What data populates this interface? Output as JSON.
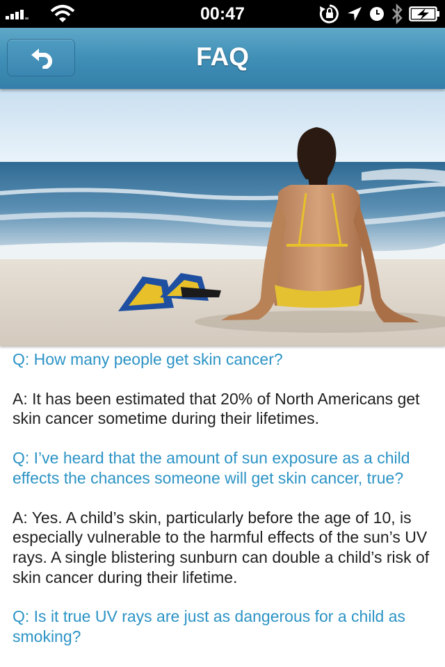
{
  "status_bar": {
    "time": "00:47"
  },
  "nav": {
    "title": "FAQ"
  },
  "faq": [
    {
      "q": "Q:  How many people get skin cancer?",
      "a": "A:  It has been estimated that 20% of North Americans get skin cancer sometime during their lifetimes."
    },
    {
      "q": "Q:  I’ve heard that the amount of sun exposure as a child effects the chances someone will get skin cancer, true?",
      "a": "A:  Yes.  A child’s skin, particularly before the age of 10, is especially vulnerable to the harmful effects of the sun’s UV rays.  A single blistering sunburn can double a child’s risk of skin cancer during their lifetime."
    },
    {
      "q": "Q:  Is it true UV rays are just as dangerous for a child as smoking?",
      "a": ""
    }
  ],
  "colors": {
    "nav_blue": "#3f8fb7",
    "question_blue": "#2b93c5",
    "answer_text": "#1e1e1e"
  },
  "icons": [
    "signal-icon",
    "wifi-icon",
    "rotation-lock-icon",
    "location-icon",
    "alarm-icon",
    "bluetooth-icon",
    "battery-charging-icon",
    "back-arrow-icon"
  ]
}
